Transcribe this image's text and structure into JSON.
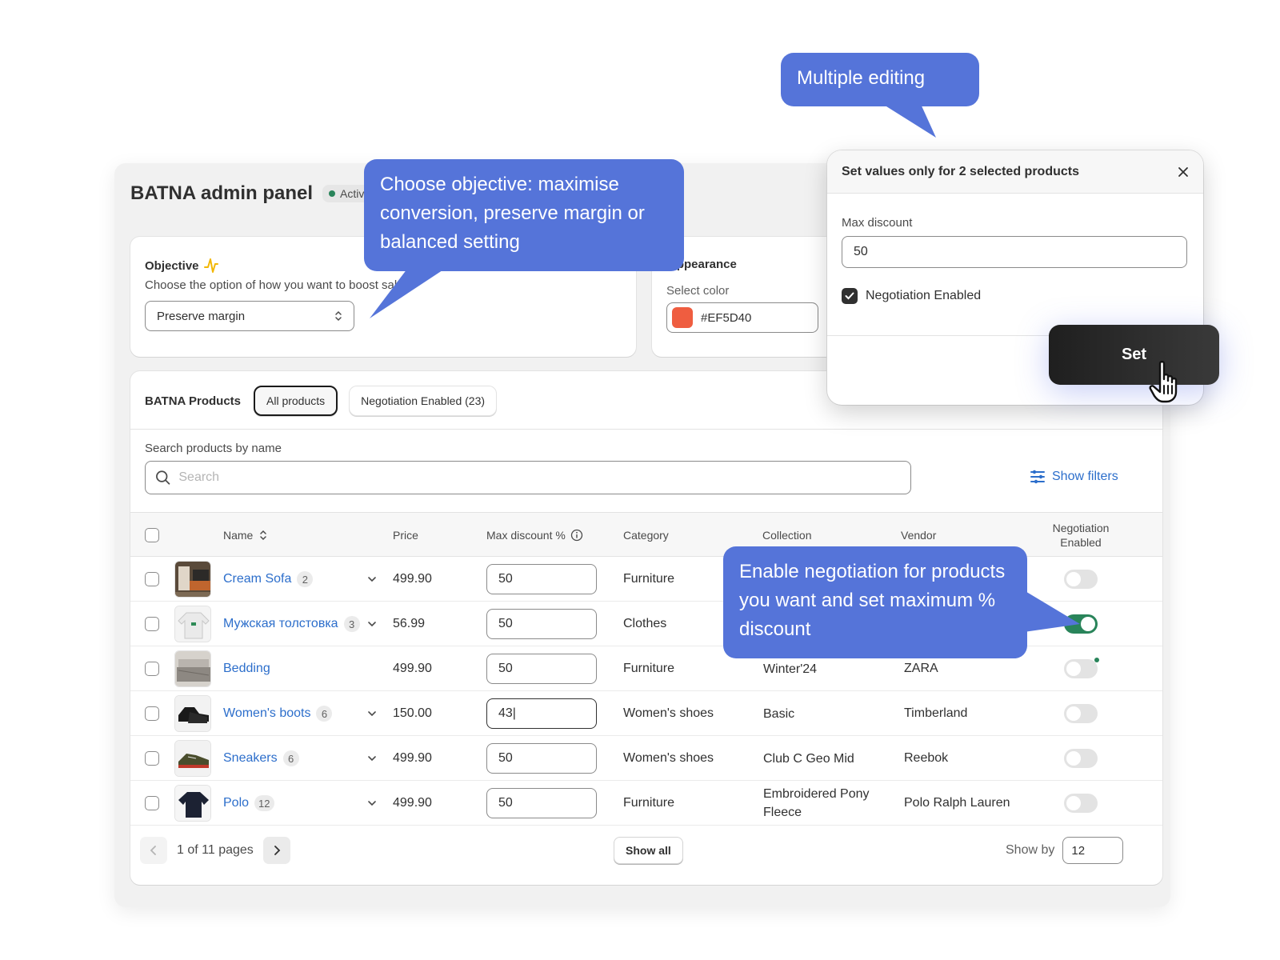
{
  "colors": {
    "accent_callout": "#5574d9",
    "link": "#2c6ecb",
    "toggle_on": "#29845a",
    "swatch": "#EF5D40"
  },
  "header": {
    "title": "BATNA admin panel",
    "status": "Activ"
  },
  "objective": {
    "title": "Objective",
    "description": "Choose the option of how you want to boost sales.",
    "selected": "Preserve margin"
  },
  "appearance": {
    "title": "Appearance",
    "color_label": "Select color",
    "color_value": "#EF5D40"
  },
  "products": {
    "title": "BATNA Products",
    "tabs": [
      "All products",
      "Negotiation Enabled (23)"
    ],
    "search_label": "Search products by name",
    "search_placeholder": "Search",
    "show_filters": "Show filters",
    "columns": {
      "name": "Name",
      "price": "Price",
      "max_discount": "Max discount %",
      "category": "Category",
      "collection": "Collection",
      "vendor": "Vendor",
      "negotiation": "Negotiation Enabled"
    },
    "rows": [
      {
        "name": "Cream Sofa",
        "count": "2",
        "price": "499.90",
        "discount": "50",
        "category": "Furniture",
        "collection": "",
        "vendor": "",
        "enabled": false,
        "thumb": "sofa"
      },
      {
        "name": "Мужская толстовка",
        "count": "3",
        "price": "56.99",
        "discount": "50",
        "category": "Clothes",
        "collection": "",
        "vendor": "",
        "enabled": true,
        "thumb": "sweater"
      },
      {
        "name": "Bedding",
        "count": "",
        "price": "499.90",
        "discount": "50",
        "category": "Furniture",
        "collection": "Winter'24",
        "vendor": "ZARA",
        "enabled": false,
        "thumb": "bed"
      },
      {
        "name": "Women's boots",
        "count": "6",
        "price": "150.00",
        "discount": "43|",
        "category": "Women's shoes",
        "collection": "Basic",
        "vendor": "Timberland",
        "enabled": false,
        "thumb": "boots"
      },
      {
        "name": "Sneakers",
        "count": "6",
        "price": "499.90",
        "discount": "50",
        "category": "Women's shoes",
        "collection": "Club C Geo Mid",
        "vendor": "Reebok",
        "enabled": false,
        "thumb": "sneakers"
      },
      {
        "name": "Polo",
        "count": "12",
        "price": "499.90",
        "discount": "50",
        "category": "Furniture",
        "collection": "Embroidered Pony Fleece",
        "vendor": "Polo Ralph Lauren",
        "enabled": false,
        "thumb": "polo"
      }
    ],
    "pager": {
      "text": "1 of 11 pages",
      "show_all": "Show all",
      "show_by_label": "Show by",
      "show_by_value": "12"
    }
  },
  "modal": {
    "title": "Set values only for 2 selected products",
    "max_discount_label": "Max discount",
    "max_discount_value": "50",
    "checkbox_label": "Negotiation Enabled",
    "set_label": "Set"
  },
  "callouts": {
    "multiple_editing": "Multiple editing",
    "objective": "Choose objective: maximise conversion, preserve margin or balanced setting",
    "negotiation": "Enable negotiation for products you want and set maximum % discount"
  }
}
